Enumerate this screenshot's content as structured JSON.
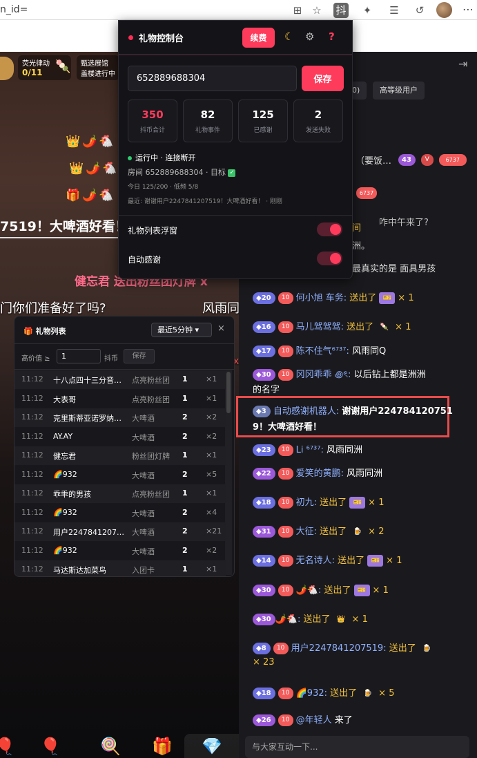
{
  "browser": {
    "url_fragment": "n_id="
  },
  "video": {
    "badge1_title": "荧光律动",
    "badge1_value": "0/11",
    "badge2_line1": "甄选展馆",
    "badge2_line2": "盖楼进行中",
    "emo_row1": "👑🌶️🐔",
    "emo_row2": "👑🌶️🐔",
    "emo_row3": "🎁🌶️🐔",
    "danmu_big": "7519！大啤酒好看！",
    "danmu_pink": "健忘君 送出粉丝团灯牌 x",
    "danmu_left": "门你们准备好了吗?",
    "danmu_right": "风雨同",
    "danmu_x": "x"
  },
  "console": {
    "title": "礼物控制台",
    "renew": "续费",
    "moon_icon": "☾",
    "gear_icon": "⚙",
    "help_icon": "?",
    "room_id": "652889688304",
    "save": "保存",
    "stats": [
      {
        "value": "350",
        "label": "抖币合计",
        "color": "#ff3b5c"
      },
      {
        "value": "82",
        "label": "礼物事件",
        "color": "#ffffff"
      },
      {
        "value": "125",
        "label": "已感谢",
        "color": "#ffffff"
      },
      {
        "value": "2",
        "label": "发送失败",
        "color": "#ffffff"
      }
    ],
    "status": "运行中 · 连接断开",
    "room_line": "房间 652889688304 · 目标",
    "today_line": "今日 125/200 · 低频 5/8",
    "recent_line": "最近: 谢谢用户2247841207519！大啤酒好看！ · 刚刚",
    "opt_float": "礼物列表浮窗",
    "opt_auto": "自动感谢"
  },
  "giftlist": {
    "title": "礼物列表",
    "range": "最近5分钟 ▾",
    "close": "×",
    "filter_label": "高价值 ≥",
    "filter_value": "1",
    "unit": "抖币",
    "save": "保存",
    "rows": [
      {
        "t": "11:12",
        "u": "十八点四十三分音…",
        "g": "点亮粉丝团",
        "n": "1",
        "x": "×1"
      },
      {
        "t": "11:12",
        "u": "大表哥",
        "g": "点亮粉丝团",
        "n": "1",
        "x": "×1"
      },
      {
        "t": "11:12",
        "u": "克里斯蒂亚诺罗纳…",
        "g": "大啤酒",
        "n": "2",
        "x": "×2"
      },
      {
        "t": "11:12",
        "u": "AY.AY",
        "g": "大啤酒",
        "n": "2",
        "x": "×2"
      },
      {
        "t": "11:12",
        "u": "健忘君",
        "g": "粉丝团灯牌",
        "n": "1",
        "x": "×1"
      },
      {
        "t": "11:12",
        "u": "🌈932",
        "g": "大啤酒",
        "n": "2",
        "x": "×5"
      },
      {
        "t": "11:12",
        "u": "乖乖的男孩",
        "g": "点亮粉丝团",
        "n": "1",
        "x": "×1"
      },
      {
        "t": "11:12",
        "u": "🌈932",
        "g": "大啤酒",
        "n": "2",
        "x": "×4"
      },
      {
        "t": "11:12",
        "u": "用户2247841207…",
        "g": "大啤酒",
        "n": "2",
        "x": "×21"
      },
      {
        "t": "11:12",
        "u": "🌈932",
        "g": "大啤酒",
        "n": "2",
        "x": "×2"
      },
      {
        "t": "11:12",
        "u": "马达斯达加菜鸟",
        "g": "入团卡",
        "n": "1",
        "x": "×1"
      }
    ]
  },
  "right": {
    "pill1": "0)",
    "pill2": "高等级用户",
    "ghost1": "（要饭…",
    "ghost1_lv": "43",
    "ghost1_fan": "6737",
    "ghost2_fan": "6737",
    "ghost_top": "咋中午来了?",
    "ghost_mid1": "间",
    "ghost_mid2": "洲。",
    "ghost_mid3": "最真实的是 面具男孩",
    "chat": [
      {
        "lv": "20",
        "name": "何小旭 车务:",
        "act": "送出了",
        "cnt": "× 1"
      },
      {
        "lv": "16",
        "name": "马儿驾驾驾:",
        "act": "送出了",
        "cnt": "× 1"
      },
      {
        "lv": "17",
        "name": "陈不住气⁶⁷³⁷:",
        "msg": "风雨同Q"
      },
      {
        "lv": "30",
        "name": "冈冈乖乖 ꩜ৎ:",
        "msg": "以后钻上都是洲洲",
        "msg2": "的名字"
      },
      {
        "lv": "3",
        "name": "自动感谢机器人:",
        "msg": "谢谢用户224784120751",
        "msg2": "9！大啤酒好看！"
      },
      {
        "lv": "23",
        "name": "Li ⁶⁷³⁷:",
        "msg": "风雨同洲"
      },
      {
        "lv": "22",
        "name": "爱笑的黄鹏:",
        "msg": "风雨同洲"
      },
      {
        "lv": "18",
        "name": "初九:",
        "act": "送出了",
        "cnt": "× 1"
      },
      {
        "lv": "31",
        "name": "大征:",
        "act": "送出了",
        "cnt": "× 2"
      },
      {
        "lv": "14",
        "name": "无名诗人:",
        "act": "送出了",
        "cnt": "× 1"
      },
      {
        "lv": "30",
        "name": "🌶️🐔:",
        "act": "送出了",
        "cnt": "× 1"
      },
      {
        "lv": "30",
        "name": "🌶️🐔:",
        "act": "送出了",
        "cnt": "× 1"
      },
      {
        "lv": "8",
        "name": "用户2247841207519:",
        "act": "送出了",
        "cnt": "× 23"
      },
      {
        "lv": "18",
        "name": "🌈932:",
        "act": "送出了",
        "cnt": "× 5"
      },
      {
        "lv": "26",
        "name": "@年轻人",
        "msg": "来了"
      }
    ],
    "input_placeholder": "与大家互动一下..."
  }
}
